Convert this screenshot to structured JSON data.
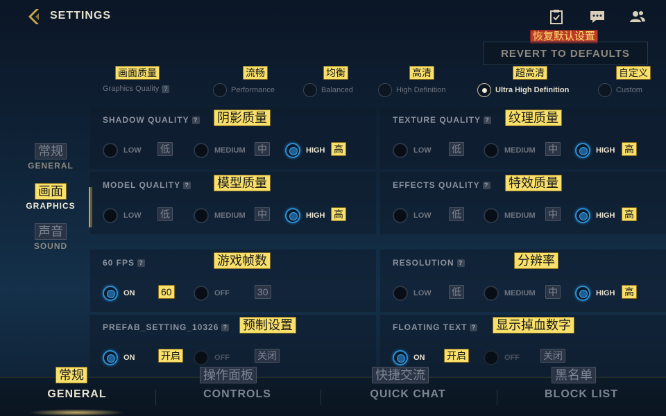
{
  "header": {
    "title": "SETTINGS"
  },
  "revert": {
    "cn": "恢复默认设置",
    "label": "REVERT TO DEFAULTS"
  },
  "graphics_quality": {
    "cn": "画面质量",
    "label": "Graphics Quality",
    "help": "?",
    "presets": [
      {
        "cn": "流畅",
        "label": "Performance",
        "selected": false
      },
      {
        "cn": "均衡",
        "label": "Balanced",
        "selected": false
      },
      {
        "cn": "高清",
        "label": "High Definition",
        "selected": false
      },
      {
        "cn": "超高清",
        "label": "Ultra High Definition",
        "selected": true
      },
      {
        "cn": "自定义",
        "label": "Custom",
        "selected": false
      }
    ]
  },
  "left_nav": [
    {
      "cn": "常规",
      "label": "GENERAL"
    },
    {
      "cn": "画面",
      "label": "GRAPHICS",
      "active": true
    },
    {
      "cn": "声音",
      "label": "SOUND"
    }
  ],
  "sections": {
    "shadow": {
      "title": "SHADOW QUALITY",
      "cn": "阴影质量",
      "options": [
        {
          "label": "LOW",
          "cn": "低"
        },
        {
          "label": "MEDIUM",
          "cn": "中"
        },
        {
          "label": "HIGH",
          "cn": "高"
        }
      ],
      "selected": "HIGH"
    },
    "texture": {
      "title": "TEXTURE QUALITY",
      "cn": "纹理质量",
      "options": [
        {
          "label": "LOW",
          "cn": "低"
        },
        {
          "label": "MEDIUM",
          "cn": "中"
        },
        {
          "label": "HIGH",
          "cn": "高"
        }
      ],
      "selected": "HIGH"
    },
    "model": {
      "title": "MODEL QUALITY",
      "cn": "模型质量",
      "options": [
        {
          "label": "LOW",
          "cn": "低"
        },
        {
          "label": "MEDIUM",
          "cn": "中"
        },
        {
          "label": "HIGH",
          "cn": "高"
        }
      ],
      "selected": "HIGH"
    },
    "effects": {
      "title": "EFFECTS QUALITY",
      "cn": "特效质量",
      "options": [
        {
          "label": "LOW",
          "cn": "低"
        },
        {
          "label": "MEDIUM",
          "cn": "中"
        },
        {
          "label": "HIGH",
          "cn": "高"
        }
      ],
      "selected": "HIGH"
    },
    "fps": {
      "title": "60 FPS",
      "cn": "游戏帧数",
      "options": [
        {
          "label": "ON",
          "cn": "60"
        },
        {
          "label": "OFF",
          "cn": "30"
        }
      ],
      "selected": "ON"
    },
    "resolution": {
      "title": "RESOLUTION",
      "cn": "分辨率",
      "options": [
        {
          "label": "LOW",
          "cn": "低"
        },
        {
          "label": "MEDIUM",
          "cn": "中"
        },
        {
          "label": "HIGH",
          "cn": "高"
        }
      ],
      "selected": "HIGH"
    },
    "prefab": {
      "title": "PREFAB_SETTING_10326",
      "cn": "预制设置",
      "options": [
        {
          "label": "ON",
          "cn": "开启"
        },
        {
          "label": "OFF",
          "cn": "关闭"
        }
      ],
      "selected": "ON"
    },
    "floating": {
      "title": "FLOATING TEXT",
      "cn": "显示掉血数字",
      "options": [
        {
          "label": "ON",
          "cn": "开启"
        },
        {
          "label": "OFF",
          "cn": "关闭"
        }
      ],
      "selected": "ON"
    }
  },
  "bottom_tabs": [
    {
      "cn": "常规",
      "label": "GENERAL",
      "active": true
    },
    {
      "cn": "操作面板",
      "label": "CONTROLS"
    },
    {
      "cn": "快捷交流",
      "label": "QUICK CHAT"
    },
    {
      "cn": "黑名单",
      "label": "BLOCK LIST"
    }
  ],
  "icons": {
    "back": "back-arrow-icon",
    "missions": "clipboard-check-icon",
    "chat": "chat-icon",
    "friends": "friends-icon"
  },
  "colors": {
    "accent_gold": "#c8a84a",
    "selected_blue": "#2d8fd0",
    "annotation_yellow": "#f8e06a",
    "annotation_red": "#c0392b"
  }
}
